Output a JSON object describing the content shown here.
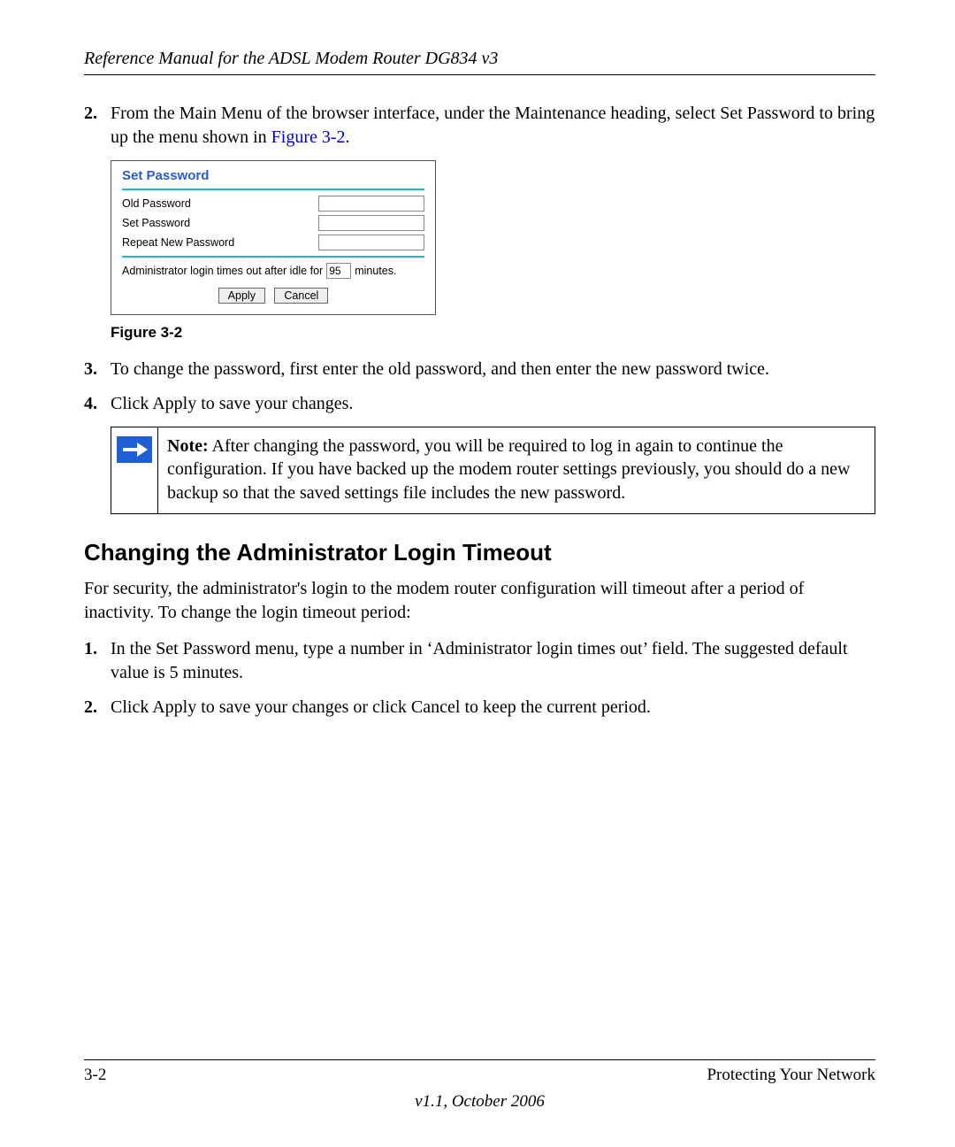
{
  "header": {
    "running_head": "Reference Manual for the ADSL Modem Router DG834 v3"
  },
  "steps_a": {
    "item2": {
      "num": "2.",
      "text_pre": "From the Main Menu of the browser interface, under the Maintenance heading, select Set Password to bring up the menu shown in ",
      "figlink": "Figure 3-2",
      "text_post": "."
    },
    "item3": {
      "num": "3.",
      "text": "To change the password, first enter the old password, and then enter the new password twice."
    },
    "item4": {
      "num": "4.",
      "text": "Click Apply to save your changes."
    }
  },
  "panel": {
    "title": "Set Password",
    "old_label": "Old Password",
    "set_label": "Set Password",
    "repeat_label": "Repeat New Password",
    "timeout_pre": "Administrator login times out after idle for",
    "timeout_value": "95",
    "timeout_post": "minutes.",
    "apply": "Apply",
    "cancel": "Cancel"
  },
  "figure": {
    "caption": "Figure 3-2"
  },
  "note": {
    "label": "Note:",
    "text": " After changing the password, you will be required to log in again to continue the configuration. If you have backed up the modem router settings previously, you should do a new backup so that the saved settings file includes the new password."
  },
  "section": {
    "heading": "Changing the Administrator Login Timeout",
    "intro": "For security, the administrator's login to the modem router configuration will timeout after a period of inactivity. To change the login timeout period:"
  },
  "steps_b": {
    "item1": {
      "num": "1.",
      "text": "In the Set Password menu, type a number in ‘Administrator login times out’ field. The suggested default value is 5 minutes."
    },
    "item2": {
      "num": "2.",
      "text": "Click Apply to save your changes or click Cancel to keep the current period."
    }
  },
  "footer": {
    "page": "3-2",
    "chapter": "Protecting Your Network",
    "version": "v1.1, October 2006"
  }
}
